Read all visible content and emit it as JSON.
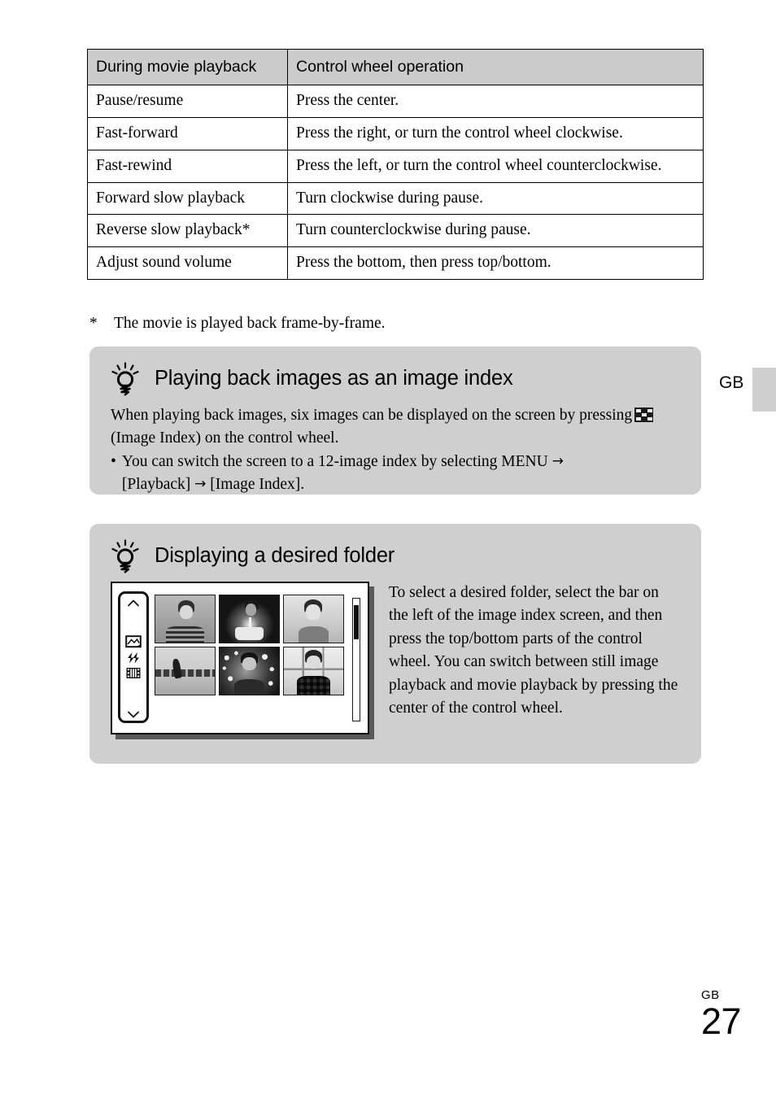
{
  "table": {
    "headers": [
      "During movie playback",
      "Control wheel operation"
    ],
    "rows": [
      [
        "Pause/resume",
        "Press the center."
      ],
      [
        "Fast-forward",
        "Press the right, or turn the control wheel clockwise."
      ],
      [
        "Fast-rewind",
        "Press the left, or turn the control wheel counterclockwise."
      ],
      [
        "Forward slow playback",
        "Turn clockwise during pause."
      ],
      [
        "Reverse slow playback*",
        "Turn counterclockwise during pause."
      ],
      [
        "Adjust sound volume",
        "Press the bottom, then press top/bottom."
      ]
    ],
    "header_bg": "#cccccc"
  },
  "footnote": {
    "mark": "*",
    "text": "The movie is played back frame-by-frame."
  },
  "tips": [
    {
      "icon": "lightbulb-icon",
      "title": "Playing back images as an image index",
      "paragraph_1a": "When playing back images, six images can be displayed on the screen by pressing",
      "inline_icon": "image-index-icon",
      "paragraph_1b": "(Image Index) on the control wheel.",
      "bullet_dot": "•",
      "bullet_line_1": "You can switch the screen to a 12-image index by selecting MENU",
      "arrow": "→",
      "bullet_line_2a": "[Playback]",
      "bullet_line_2b": "[Image Index]."
    },
    {
      "icon": "lightbulb-icon",
      "title": "Displaying a desired folder",
      "body": "To select a desired folder, select the bar on the left of the image index screen, and then press the top/bottom parts of the control wheel. You can switch between still image playback and movie playback by pressing the center of the control wheel."
    }
  ],
  "illustration": {
    "name": "image-index-screen",
    "folder_bar": {
      "up_chevron": "chevron-up-icon",
      "down_chevron": "chevron-down-icon",
      "icons": [
        "still-image-icon",
        "switch-arrows-icon",
        "movie-filmstrip-icon"
      ]
    },
    "thumbnails": [
      "boy-portrait-photo",
      "birthday-cake-photo",
      "boy-window-photo",
      "runner-track-photo",
      "boy-bokeh-lights-photo",
      "boy-plaid-window-photo"
    ],
    "scrollbar": "vertical-scrollbar"
  },
  "page_marker": {
    "side_label": "GB"
  },
  "footer": {
    "region": "GB",
    "page_number": "27"
  }
}
